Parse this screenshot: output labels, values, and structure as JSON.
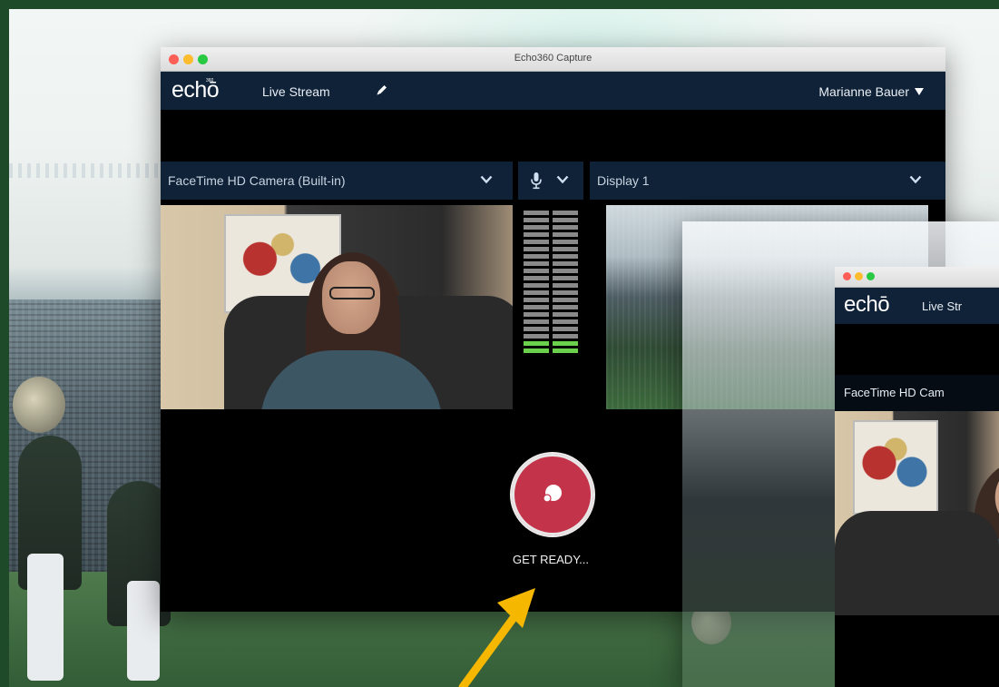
{
  "window": {
    "title": "Echo360 Capture"
  },
  "appbar": {
    "logo": "echō",
    "logo_superscript": "360",
    "section_label": "Live Stream",
    "user_name": "Marianne Bauer"
  },
  "sources": {
    "camera": "FaceTime HD Camera (Built-in)",
    "display": "Display 1"
  },
  "audio_meter": {
    "segments": 20,
    "active_segments": 2
  },
  "capture": {
    "status": "GET READY..."
  },
  "second_window": {
    "logo": "echō",
    "section_label": "Live Str",
    "camera": "FaceTime HD Cam"
  },
  "colors": {
    "app_bar": "#0f2238",
    "record_button": "#c3334a",
    "meter_active": "#6bd04b",
    "annotation_arrow": "#f5b700"
  },
  "icons": {
    "edit": "pencil-icon",
    "user_menu": "caret-down-icon",
    "dropdown": "chevron-down-icon",
    "microphone": "microphone-icon",
    "record": "record-icon"
  }
}
